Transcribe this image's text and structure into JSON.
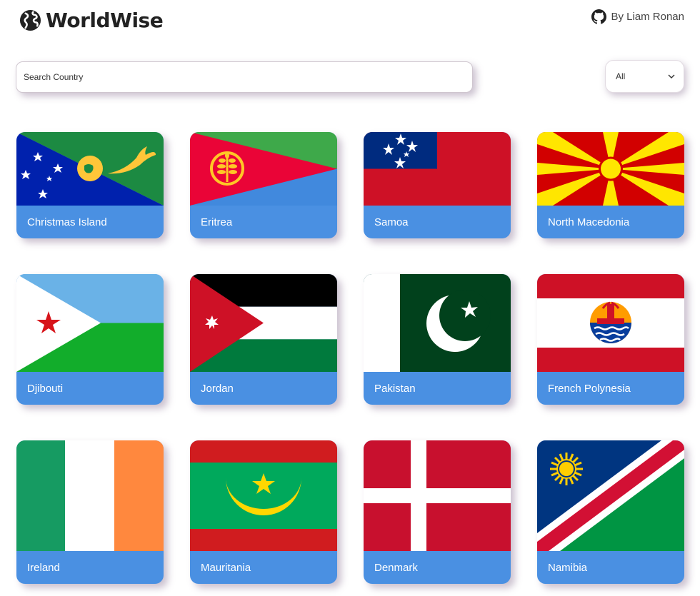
{
  "app": {
    "title": "WorldWise",
    "author": "By Liam Ronan"
  },
  "search": {
    "placeholder": "Search Country",
    "value": ""
  },
  "filter": {
    "selected": "All"
  },
  "countries": [
    {
      "name": "Christmas Island",
      "flag": "christmas-island-flag-icon"
    },
    {
      "name": "Eritrea",
      "flag": "eritrea-flag-icon"
    },
    {
      "name": "Samoa",
      "flag": "samoa-flag-icon"
    },
    {
      "name": "North Macedonia",
      "flag": "north-macedonia-flag-icon"
    },
    {
      "name": "Djibouti",
      "flag": "djibouti-flag-icon"
    },
    {
      "name": "Jordan",
      "flag": "jordan-flag-icon"
    },
    {
      "name": "Pakistan",
      "flag": "pakistan-flag-icon"
    },
    {
      "name": "French Polynesia",
      "flag": "french-polynesia-flag-icon"
    },
    {
      "name": "Ireland",
      "flag": "ireland-flag-icon"
    },
    {
      "name": "Mauritania",
      "flag": "mauritania-flag-icon"
    },
    {
      "name": "Denmark",
      "flag": "denmark-flag-icon"
    },
    {
      "name": "Namibia",
      "flag": "namibia-flag-icon"
    }
  ],
  "colors": {
    "card_accent": "#4a90e2",
    "text": "#222222"
  }
}
